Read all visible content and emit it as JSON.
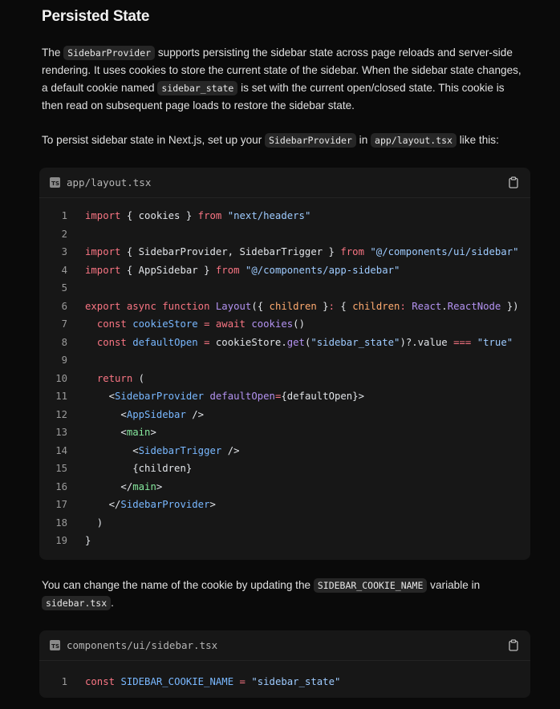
{
  "section": {
    "title": "Persisted State"
  },
  "para1": {
    "t1": "The ",
    "c1": "SidebarProvider",
    "t2": " supports persisting the sidebar state across page reloads and server-side rendering. It uses cookies to store the current state of the sidebar. When the sidebar state changes, a default cookie named ",
    "c2": "sidebar_state",
    "t3": " is set with the current open/closed state. This cookie is then read on subsequent page loads to restore the sidebar state."
  },
  "para2": {
    "t1": "To persist sidebar state in Next.js, set up your ",
    "c1": "SidebarProvider",
    "t2": " in ",
    "c2": "app/layout.tsx",
    "t3": " like this:"
  },
  "para3": {
    "t1": "You can change the name of the cookie by updating the ",
    "c1": "SIDEBAR_COOKIE_NAME",
    "t2": " variable in ",
    "c2": "sidebar.tsx",
    "t3": "."
  },
  "code_block_1": {
    "filename": "app/layout.tsx",
    "lang_badge": "TS",
    "lines": [
      {
        "n": "1",
        "tokens": [
          [
            "kw",
            "import"
          ],
          [
            "pl",
            " { cookies } "
          ],
          [
            "kw",
            "from"
          ],
          [
            "pl",
            " "
          ],
          [
            "str",
            "\"next/headers\""
          ]
        ]
      },
      {
        "n": "2",
        "tokens": []
      },
      {
        "n": "3",
        "tokens": [
          [
            "kw",
            "import"
          ],
          [
            "pl",
            " { SidebarProvider, SidebarTrigger } "
          ],
          [
            "kw",
            "from"
          ],
          [
            "pl",
            " "
          ],
          [
            "str",
            "\"@/components/ui/sidebar\""
          ]
        ]
      },
      {
        "n": "4",
        "tokens": [
          [
            "kw",
            "import"
          ],
          [
            "pl",
            " { AppSidebar } "
          ],
          [
            "kw",
            "from"
          ],
          [
            "pl",
            " "
          ],
          [
            "str",
            "\"@/components/app-sidebar\""
          ]
        ]
      },
      {
        "n": "5",
        "tokens": []
      },
      {
        "n": "6",
        "tokens": [
          [
            "kw",
            "export"
          ],
          [
            "pl",
            " "
          ],
          [
            "kw",
            "async"
          ],
          [
            "pl",
            " "
          ],
          [
            "kw",
            "function"
          ],
          [
            "pl",
            " "
          ],
          [
            "fn",
            "Layout"
          ],
          [
            "pl",
            "({ "
          ],
          [
            "prm",
            "children"
          ],
          [
            "pl",
            " }"
          ],
          [
            "kw",
            ":"
          ],
          [
            "pl",
            " { "
          ],
          [
            "prm",
            "children"
          ],
          [
            "kw",
            ":"
          ],
          [
            "pl",
            " "
          ],
          [
            "fn",
            "React"
          ],
          [
            "pl",
            "."
          ],
          [
            "fn",
            "ReactNode"
          ],
          [
            "pl",
            " })"
          ]
        ]
      },
      {
        "n": "7",
        "tokens": [
          [
            "pl",
            "  "
          ],
          [
            "kw",
            "const"
          ],
          [
            "pl",
            " "
          ],
          [
            "var",
            "cookieStore"
          ],
          [
            "pl",
            " "
          ],
          [
            "kw",
            "="
          ],
          [
            "pl",
            " "
          ],
          [
            "kw",
            "await"
          ],
          [
            "pl",
            " "
          ],
          [
            "fn",
            "cookies"
          ],
          [
            "pl",
            "()"
          ]
        ]
      },
      {
        "n": "8",
        "tokens": [
          [
            "pl",
            "  "
          ],
          [
            "kw",
            "const"
          ],
          [
            "pl",
            " "
          ],
          [
            "var",
            "defaultOpen"
          ],
          [
            "pl",
            " "
          ],
          [
            "kw",
            "="
          ],
          [
            "pl",
            " cookieStore."
          ],
          [
            "fn",
            "get"
          ],
          [
            "pl",
            "("
          ],
          [
            "str",
            "\"sidebar_state\""
          ],
          [
            "pl",
            ")?.value "
          ],
          [
            "kw",
            "==="
          ],
          [
            "pl",
            " "
          ],
          [
            "str",
            "\"true\""
          ]
        ]
      },
      {
        "n": "9",
        "tokens": []
      },
      {
        "n": "10",
        "tokens": [
          [
            "pl",
            "  "
          ],
          [
            "kw",
            "return"
          ],
          [
            "pl",
            " ("
          ]
        ]
      },
      {
        "n": "11",
        "tokens": [
          [
            "pl",
            "    <"
          ],
          [
            "cmp",
            "SidebarProvider"
          ],
          [
            "pl",
            " "
          ],
          [
            "fn",
            "defaultOpen"
          ],
          [
            "kw",
            "="
          ],
          [
            "pl",
            "{defaultOpen}>"
          ]
        ]
      },
      {
        "n": "12",
        "tokens": [
          [
            "pl",
            "      <"
          ],
          [
            "cmp",
            "AppSidebar"
          ],
          [
            "pl",
            " />"
          ]
        ]
      },
      {
        "n": "13",
        "tokens": [
          [
            "pl",
            "      <"
          ],
          [
            "tag",
            "main"
          ],
          [
            "pl",
            ">"
          ]
        ]
      },
      {
        "n": "14",
        "tokens": [
          [
            "pl",
            "        <"
          ],
          [
            "cmp",
            "SidebarTrigger"
          ],
          [
            "pl",
            " />"
          ]
        ]
      },
      {
        "n": "15",
        "tokens": [
          [
            "pl",
            "        {children}"
          ]
        ]
      },
      {
        "n": "16",
        "tokens": [
          [
            "pl",
            "      </"
          ],
          [
            "tag",
            "main"
          ],
          [
            "pl",
            ">"
          ]
        ]
      },
      {
        "n": "17",
        "tokens": [
          [
            "pl",
            "    </"
          ],
          [
            "cmp",
            "SidebarProvider"
          ],
          [
            "pl",
            ">"
          ]
        ]
      },
      {
        "n": "18",
        "tokens": [
          [
            "pl",
            "  )"
          ]
        ]
      },
      {
        "n": "19",
        "tokens": [
          [
            "pl",
            "}"
          ]
        ]
      }
    ]
  },
  "code_block_2": {
    "filename": "components/ui/sidebar.tsx",
    "lang_badge": "TS",
    "lines": [
      {
        "n": "1",
        "tokens": [
          [
            "kw",
            "const"
          ],
          [
            "pl",
            " "
          ],
          [
            "var",
            "SIDEBAR_COOKIE_NAME"
          ],
          [
            "pl",
            " "
          ],
          [
            "kw",
            "="
          ],
          [
            "pl",
            " "
          ],
          [
            "str",
            "\"sidebar_state\""
          ]
        ]
      }
    ]
  }
}
